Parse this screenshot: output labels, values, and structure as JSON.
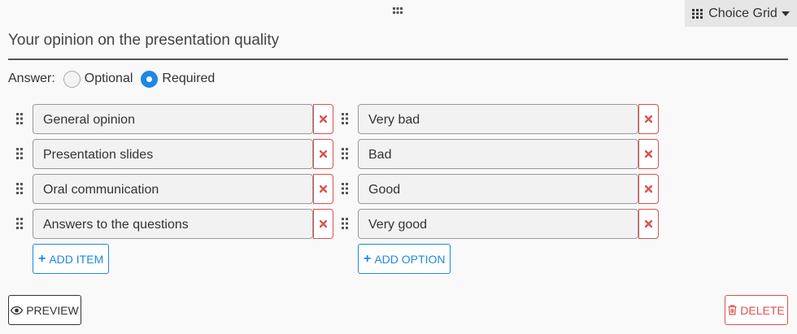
{
  "header": {
    "drag_handle_icon": "grip-horizontal-icon",
    "type_selector": {
      "icon": "grid-icon",
      "label": "Choice Grid",
      "caret_icon": "caret-down-icon"
    }
  },
  "question": {
    "title": "Your opinion on the presentation quality"
  },
  "answer": {
    "label": "Answer:",
    "options": [
      {
        "label": "Optional",
        "selected": false
      },
      {
        "label": "Required",
        "selected": true
      }
    ]
  },
  "items": [
    {
      "value": "General opinion"
    },
    {
      "value": "Presentation slides"
    },
    {
      "value": "Oral communication"
    },
    {
      "value": "Answers to the questions"
    }
  ],
  "options": [
    {
      "value": "Very bad"
    },
    {
      "value": "Bad"
    },
    {
      "value": "Good"
    },
    {
      "value": "Very good"
    }
  ],
  "buttons": {
    "add_item": "ADD ITEM",
    "add_option": "ADD OPTION",
    "preview": "PREVIEW",
    "delete": "DELETE"
  },
  "colors": {
    "accent": "#1e88e5",
    "danger": "#d9534f",
    "text": "#333333"
  }
}
